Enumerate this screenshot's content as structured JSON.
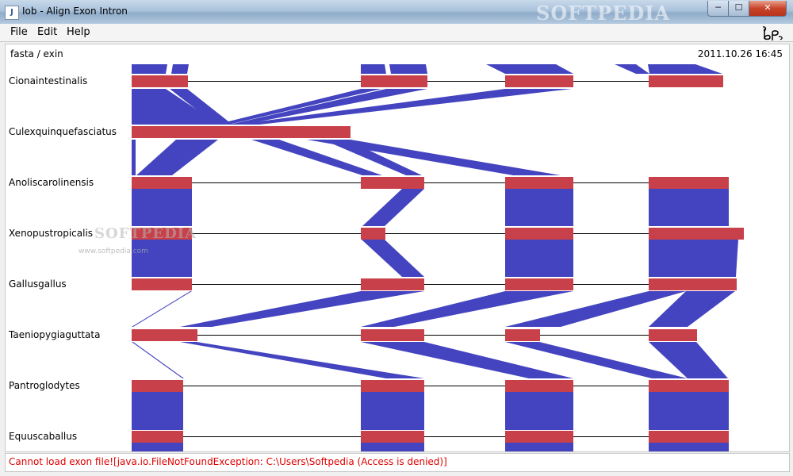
{
  "window": {
    "title": "Iob - Align Exon Intron",
    "app_icon": "java-icon",
    "watermark": "SOFTPEDIA",
    "controls": {
      "minimize": "─",
      "maximize": "☐",
      "close": "✕"
    }
  },
  "menu": {
    "items": [
      "File",
      "Edit",
      "Help"
    ],
    "logo": "bp-logo-icon"
  },
  "info": {
    "path": "fasta / exin",
    "timestamp": "2011.10.26 16:45"
  },
  "species": [
    "Cionaintestinalis",
    "Culexquinquefasciatus",
    "Anoliscarolinensis",
    "Xenopustropicalis",
    "Gallusgallus",
    "Taeniopygiaguttata",
    "Pantroglodytes",
    "Equuscaballus"
  ],
  "canvas_watermark": {
    "title": "SOFTPEDIA",
    "url": "www.softpedia.com"
  },
  "status": {
    "message": "Cannot load exon file![java.io.FileNotFoundException: C:\\Users\\Softpedia (Access is denied)]"
  },
  "colors": {
    "exon": "#c8404a",
    "band": "#4444c0",
    "error_text": "#e00000",
    "intron": "#000000"
  }
}
